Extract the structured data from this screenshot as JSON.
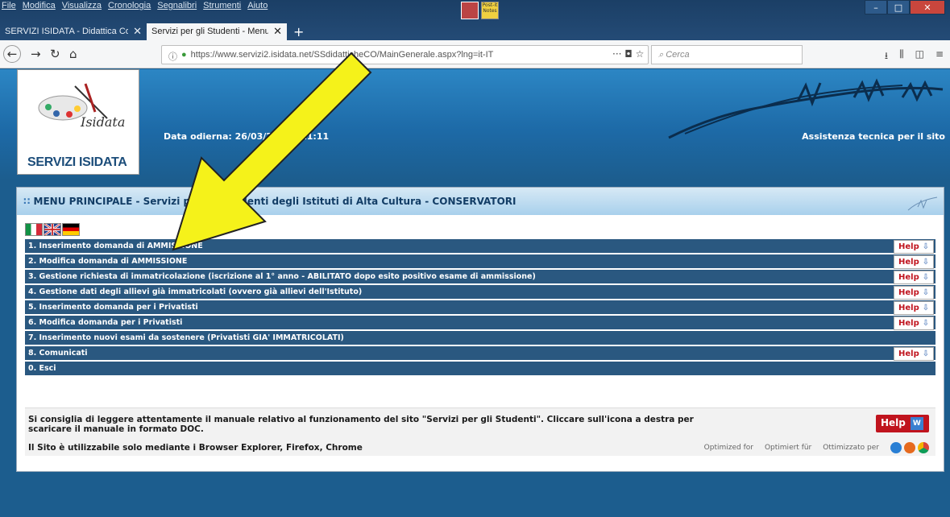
{
  "browser": {
    "menu": [
      "File",
      "Modifica",
      "Visualizza",
      "Cronologia",
      "Segnalibri",
      "Strumenti",
      "Aiuto"
    ],
    "tabs": [
      {
        "label": "SERVIZI ISIDATA - Didattica Conse",
        "active": false
      },
      {
        "label": "Servizi per gli Studenti - Menu prin",
        "active": true
      }
    ],
    "new_tab": "+",
    "url": "https://www.servizi2.isidata.net/SSdidatticheCO/MainGenerale.aspx?lng=it-IT",
    "url_actions": "··· ◘ ☆",
    "search_placeholder": "Cerca",
    "sticky_label": "Post-it Notes"
  },
  "site": {
    "logo_title": "SERVIZI ISIDATA",
    "logo_wordmark": "Isidata",
    "date_label": "Data odierna: 26/03/2018 - 11:11",
    "support_link": "Assistenza tecnica per il sito"
  },
  "panel": {
    "title": "MENU PRINCIPALE - Servizi per gli Studenti degli Istituti di Alta Cultura - CONSERVATORI",
    "menu": [
      {
        "label": "1. Inserimento domanda di AMMISSIONE",
        "help": true
      },
      {
        "label": "2. Modifica domanda di AMMISSIONE",
        "help": true
      },
      {
        "label": "3. Gestione richiesta di immatricolazione (iscrizione al 1° anno - ABILITATO dopo esito positivo esame di ammissione)",
        "help": true
      },
      {
        "label": "4. Gestione dati degli allievi già immatricolati (ovvero già allievi dell'Istituto)",
        "help": true
      },
      {
        "label": "5. Inserimento domanda per i Privatisti",
        "help": true
      },
      {
        "label": "6. Modifica domanda per i Privatisti",
        "help": true
      },
      {
        "label": "7. Inserimento nuovi esami da sostenere (Privatisti GIA' IMMATRICOLATI)",
        "help": false
      },
      {
        "label": "8. Comunicati",
        "help": true
      },
      {
        "label": "0. Esci",
        "help": false
      }
    ],
    "help_label": "Help",
    "info_text": "Si consiglia di leggere attentamente il manuale relativo al funzionamento del sito \"Servizi per gli Studenti\". Cliccare sull'icona a destra per scaricare il manuale in formato DOC.",
    "browsers_text": "Il Sito è utilizzabile solo mediante i Browser Explorer, Firefox, Chrome",
    "manual_help_label": "Help",
    "optimized": [
      "Optimized for",
      "Optimiert für",
      "Ottimizzato per"
    ]
  },
  "colors": {
    "menu_row": "#2a5880",
    "help_text": "#c0141e",
    "arrow": "#f5f21a"
  }
}
